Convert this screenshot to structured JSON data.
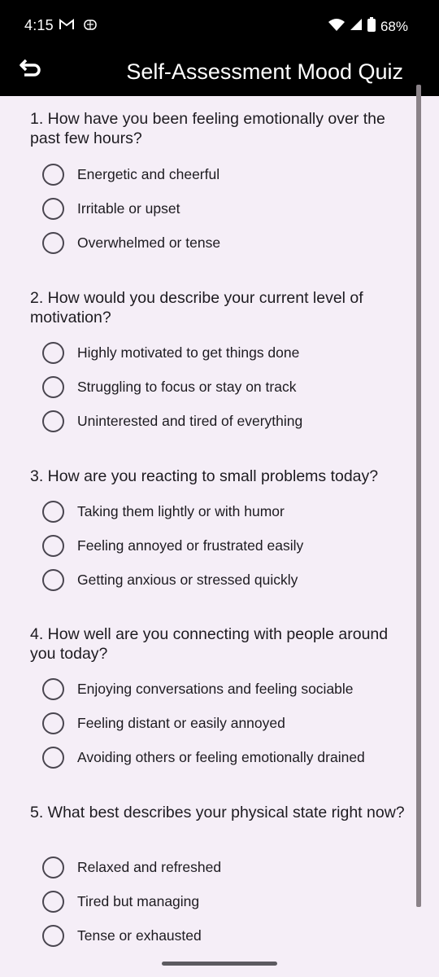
{
  "status_bar": {
    "time": "4:15",
    "battery": "68%",
    "icons": [
      "gmail-icon",
      "debug-icon",
      "wifi-icon",
      "signal-icon",
      "battery-icon"
    ]
  },
  "app_bar": {
    "title": "Self-Assessment Mood Quiz",
    "back_icon": "back-icon"
  },
  "questions": [
    {
      "text": "1. How have you been feeling emotionally over the past few hours?",
      "options": [
        "Energetic and cheerful",
        "Irritable or upset",
        "Overwhelmed or tense"
      ],
      "selected": null
    },
    {
      "text": "2. How would you describe your current level of motivation?",
      "options": [
        "Highly motivated to get things done",
        "Struggling to focus or stay on track",
        "Uninterested and tired of everything"
      ],
      "selected": null
    },
    {
      "text": "3. How are you reacting to small problems today?",
      "options": [
        "Taking them lightly or with humor",
        "Feeling annoyed or frustrated easily",
        "Getting anxious or stressed quickly"
      ],
      "selected": null
    },
    {
      "text": "4. How well are you connecting with people around you today?",
      "options": [
        "Enjoying conversations and feeling sociable",
        "Feeling distant or easily annoyed",
        "Avoiding others or feeling emotionally drained"
      ],
      "selected": null
    },
    {
      "text": "5. What best describes your physical state right now?",
      "options": [
        "Relaxed and refreshed",
        "Tired but managing",
        "Tense or exhausted"
      ],
      "selected": null
    }
  ],
  "colors": {
    "background": "#f5eef7",
    "app_bar": "#000000",
    "radio_border": "#49454f",
    "text": "#1d1b20"
  }
}
